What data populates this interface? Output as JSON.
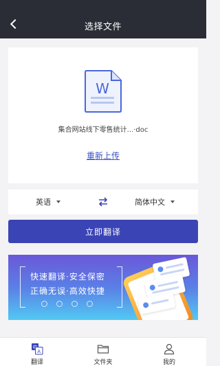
{
  "header": {
    "title": "选择文件"
  },
  "file": {
    "name": "集合网站线下零售统计...·doc",
    "icon_letter": "W",
    "reupload_label": "重新上传"
  },
  "languages": {
    "source": "英语",
    "target": "简体中文"
  },
  "actions": {
    "translate_label": "立即翻译"
  },
  "banner": {
    "slogan_line1": "快速翻译·安全保密",
    "slogan_line2": "正确无误·高效快捷"
  },
  "tabs": [
    {
      "label": "翻译",
      "icon": "translate-icon",
      "active": true
    },
    {
      "label": "文件夹",
      "icon": "folder-icon",
      "active": false
    },
    {
      "label": "我的",
      "icon": "user-icon",
      "active": false
    }
  ],
  "colors": {
    "header_bg": "#2b2d36",
    "accent": "#3a44b5",
    "link": "#3d52c3",
    "background": "#f3f3f5"
  }
}
